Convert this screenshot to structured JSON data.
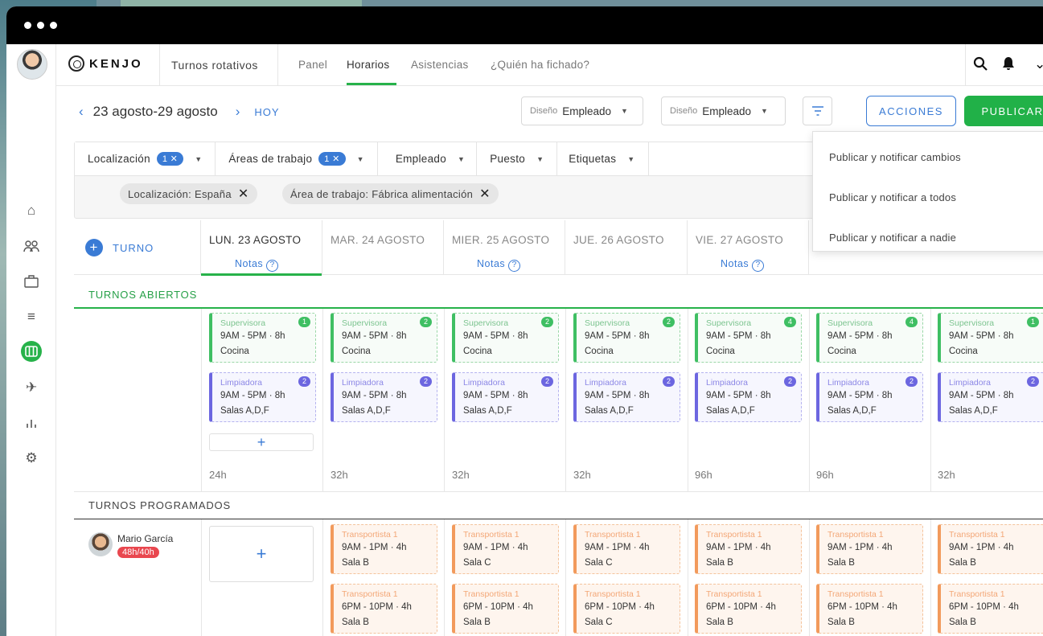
{
  "app": {
    "brand": "KENJO",
    "section_title": "Turnos rotativos"
  },
  "nav": {
    "links": [
      "Panel",
      "Horarios",
      "Asistencias",
      "¿Quién ha fichado?"
    ],
    "active": "Horarios"
  },
  "toolbar": {
    "date_range": "23 agosto-29 agosto",
    "today_label": "HOY",
    "design_selects": [
      {
        "label": "Diseño",
        "value": "Empleado"
      },
      {
        "label": "Diseño",
        "value": "Empleado"
      }
    ],
    "actions_label": "ACCIONES",
    "publish_label": "PUBLICAR"
  },
  "publish_menu": [
    "Publicar y notificar cambios",
    "Publicar y notificar a todos",
    "Publicar y notificar a nadie"
  ],
  "filters": {
    "items": [
      {
        "label": "Localización",
        "count": "1 ✕"
      },
      {
        "label": "Áreas de trabajo",
        "count": "1 ✕"
      },
      {
        "label": "Empleado",
        "count": ""
      },
      {
        "label": "Puesto",
        "count": ""
      },
      {
        "label": "Etiquetas",
        "count": ""
      }
    ],
    "chips": [
      "Localización: España",
      "Área de trabajo: Fábrica alimentación"
    ]
  },
  "calendar": {
    "add_shift_label": "TURNO",
    "notes_label": "Notas",
    "days": [
      "LUN. 23 AGOSTO",
      "MAR. 24 AGOSTO",
      "MIER. 25 AGOSTO",
      "JUE. 26 AGOSTO",
      "VIE. 27 AGOSTO"
    ],
    "notes_visible": [
      true,
      false,
      true,
      false,
      true
    ],
    "open_title": "TURNOS ABIERTOS",
    "scheduled_title": "TURNOS PROGRAMADOS",
    "open_shifts": [
      {
        "role": "Supervisora",
        "time": "9AM - 5PM · 8h",
        "location": "Cocina",
        "counts": [
          "1",
          "2",
          "2",
          "2",
          "4",
          "4",
          "1"
        ]
      },
      {
        "role": "Limpiadora",
        "time": "9AM - 5PM · 8h",
        "location": "Salas A,D,F",
        "counts": [
          "2",
          "2",
          "2",
          "2",
          "2",
          "2",
          "2"
        ]
      }
    ],
    "hours": [
      "24h",
      "32h",
      "32h",
      "32h",
      "96h",
      "96h",
      "32h"
    ],
    "employee": {
      "name": "Mario García",
      "hours_badge": "48h/40h"
    },
    "scheduled_morning": {
      "role": "Transportista 1",
      "time": "9AM - 1PM · 4h",
      "locations": [
        "Sala B",
        "Sala C",
        "Sala C",
        "Sala B",
        "Sala B",
        "Sala B"
      ]
    },
    "scheduled_evening": {
      "role": "Transportista 1",
      "time": "6PM - 10PM · 4h",
      "locations": [
        "Sala B",
        "Sala B",
        "Sala C",
        "Sala B",
        "Sala B",
        "Sala B"
      ]
    }
  },
  "colors": {
    "accent_blue": "#3a7bd5",
    "green": "#27b24a",
    "purple": "#6c66e0",
    "orange": "#f29a5c",
    "alert_red": "#e9474f"
  },
  "icons": [
    "search-icon",
    "bell-icon",
    "home-icon",
    "people-icon",
    "briefcase-icon",
    "list-icon",
    "shifts-icon",
    "plane-icon",
    "chart-icon",
    "settings-icon"
  ]
}
